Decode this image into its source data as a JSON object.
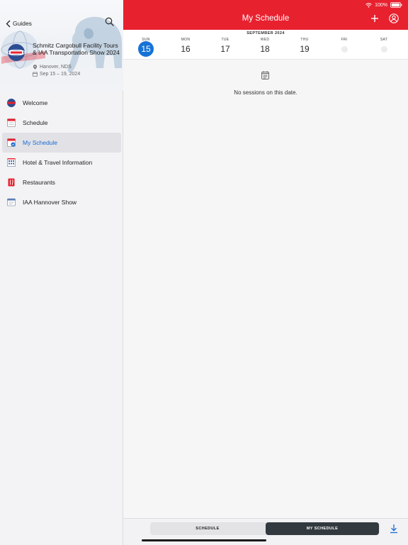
{
  "sidebar": {
    "back_label": "Guides",
    "event": {
      "title": "Schmitz Cargobull Facility Tours & IAA Transportation Show 2024",
      "location": "Hanover, NDS",
      "dates": "Sep 15 – 19, 2024"
    },
    "menu": [
      {
        "label": "Welcome",
        "icon": "logo-icon",
        "active": false
      },
      {
        "label": "Schedule",
        "icon": "schedule-icon",
        "active": false
      },
      {
        "label": "My Schedule",
        "icon": "my-schedule-icon",
        "active": true
      },
      {
        "label": "Hotel & Travel Information",
        "icon": "hotel-icon",
        "active": false
      },
      {
        "label": "Restaurants",
        "icon": "restaurant-icon",
        "active": false
      },
      {
        "label": "IAA Hannover Show",
        "icon": "document-icon",
        "active": false
      }
    ]
  },
  "status": {
    "battery": "100%"
  },
  "header": {
    "title": "My Schedule"
  },
  "calendar": {
    "month": "SEPTEMBER 2024",
    "days": [
      {
        "name": "SUN",
        "number": "15",
        "selected": true
      },
      {
        "name": "MON",
        "number": "16"
      },
      {
        "name": "TUE",
        "number": "17"
      },
      {
        "name": "WED",
        "number": "18"
      },
      {
        "name": "THU",
        "number": "19"
      },
      {
        "name": "FRI",
        "number": ""
      },
      {
        "name": "SAT",
        "number": ""
      }
    ]
  },
  "content": {
    "empty_message": "No sessions on this date."
  },
  "bottom": {
    "tabs": [
      "SCHEDULE",
      "MY SCHEDULE"
    ],
    "selected_tab": 1
  },
  "colors": {
    "accent": "#e8212f",
    "selected_day": "#1673d6",
    "link": "#1b6bd1",
    "segment_active": "#333a3f"
  }
}
